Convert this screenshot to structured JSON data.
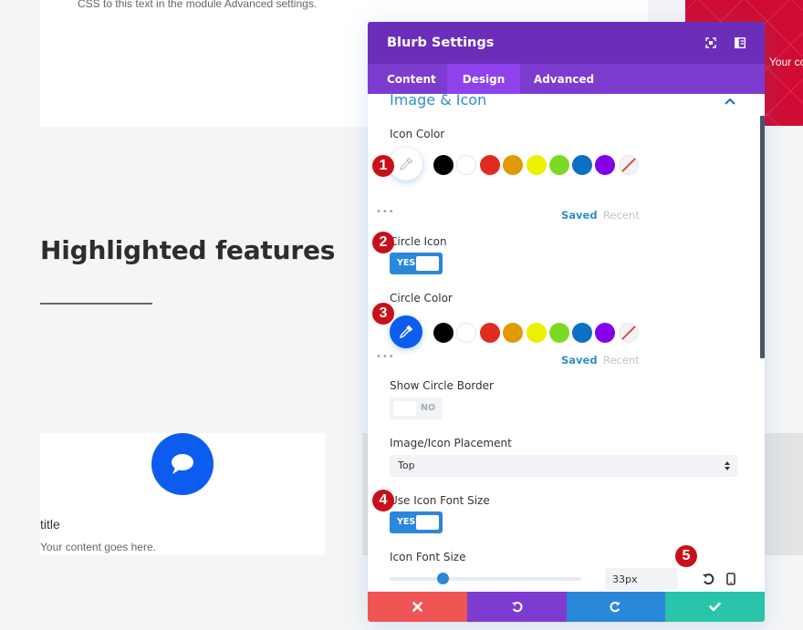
{
  "background": {
    "top_card_text": "CSS to this text in the module Advanced settings.",
    "red_card_text": "Your co",
    "headline": "Highlighted features",
    "blurb": {
      "icon": "chat-bubble-icon",
      "icon_circle_color": "#0c5cf0",
      "title": "title",
      "content": "Your content goes here."
    }
  },
  "modal": {
    "title": "Blurb Settings",
    "header_icons": [
      "expand-icon",
      "sidebar-layout-icon"
    ],
    "tabs": [
      {
        "label": "Content",
        "active": false
      },
      {
        "label": "Design",
        "active": true
      },
      {
        "label": "Advanced",
        "active": false
      }
    ],
    "section": {
      "title": "Image & Icon",
      "expanded": true
    },
    "fields": {
      "icon_color": {
        "label": "Icon Color",
        "value": "none",
        "saved_label": "Saved",
        "recent_label": "Recent",
        "more_label": "•••"
      },
      "circle_icon": {
        "label": "Circle Icon",
        "toggle_label": "YES",
        "value": true
      },
      "circle_color": {
        "label": "Circle Color",
        "value": "#0c5cf0",
        "saved_label": "Saved",
        "recent_label": "Recent",
        "more_label": "•••"
      },
      "show_circle_border": {
        "label": "Show Circle Border",
        "toggle_label": "NO",
        "value": false
      },
      "placement": {
        "label": "Image/Icon Placement",
        "value": "Top"
      },
      "use_icon_font_size": {
        "label": "Use Icon Font Size",
        "toggle_label": "YES",
        "value": true
      },
      "icon_font_size": {
        "label": "Icon Font Size",
        "value": "33px",
        "slider_fraction": 0.28
      }
    },
    "swatches": [
      "#000000",
      "#ffffff",
      "#e02b20",
      "#e09900",
      "#edf000",
      "#7cda24",
      "#0c71c3",
      "#8300e9",
      "none"
    ],
    "footer": {
      "cancel": "close-icon",
      "undo": "undo-icon",
      "redo": "redo-icon",
      "save": "check-icon"
    }
  },
  "annotations": [
    "1",
    "2",
    "3",
    "4",
    "5"
  ],
  "colors": {
    "header_purple": "#6c2eb9",
    "tab_purple": "#7d3bcf",
    "tab_active": "#8f42ec",
    "accent_blue": "#2b87da",
    "cancel_red": "#ef5555",
    "save_green": "#29c4a9",
    "badge_red": "#c8101a"
  }
}
